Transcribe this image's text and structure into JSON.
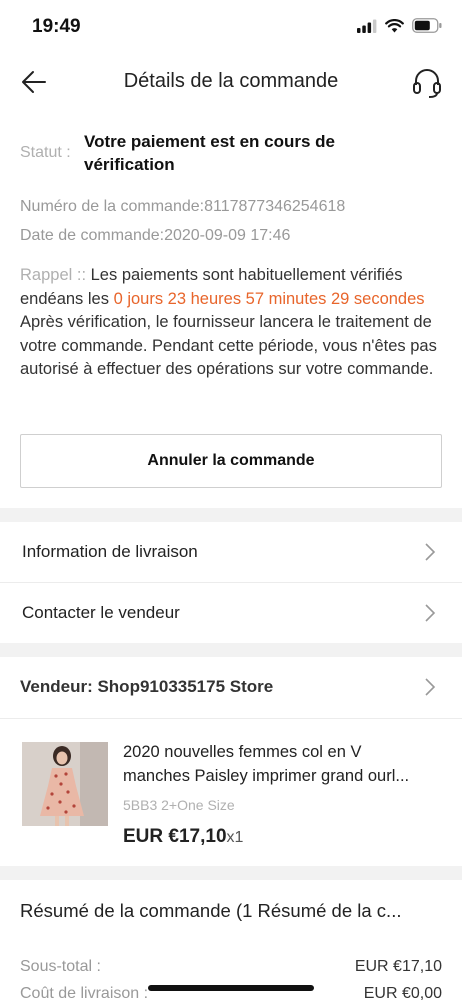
{
  "status_bar": {
    "time": "19:49"
  },
  "header": {
    "title": "Détails de la commande"
  },
  "order": {
    "status_label": "Statut :",
    "status_value": "Votre paiement est en cours de vérification",
    "number_line": "Numéro de la commande:8117877346254618",
    "date_line": "Date de commande:2020-09-09 17:46"
  },
  "reminder": {
    "label": "Rappel ::",
    "text_before": " Les paiements sont habituellement vérifiés endéans les ",
    "countdown": "0 jours 23 heures 57 minutes 29 secondes",
    "text_after": " Après vérification, le fournisseur lancera le traitement de votre commande. Pendant cette période, vous n'êtes pas autorisé à effectuer des opérations sur votre commande."
  },
  "actions": {
    "cancel_label": "Annuler la commande"
  },
  "links": {
    "delivery_info": "Information de livraison",
    "contact_seller": "Contacter le vendeur"
  },
  "seller": {
    "label": "Vendeur: Shop910335175 Store"
  },
  "product": {
    "name_line1": "2020 nouvelles femmes col en V",
    "name_line2": "manches Paisley imprimer grand ourl...",
    "variant": "5BB3 2+One Size",
    "price": "EUR €17,10",
    "qty": "x1"
  },
  "summary": {
    "title": "Résumé de la commande (1 Résumé de la c...",
    "rows": [
      {
        "label": "Sous-total :",
        "value": "EUR €17,10"
      },
      {
        "label": "Coût de livraison :",
        "value": "EUR €0,00"
      }
    ]
  },
  "colors": {
    "accent": "#e8652b",
    "muted": "#b0b0b0",
    "separator": "#f2f2f2"
  },
  "icons": [
    "back-arrow-icon",
    "headset-icon",
    "chevron-right-icon",
    "signal-icon",
    "wifi-icon",
    "battery-icon"
  ]
}
